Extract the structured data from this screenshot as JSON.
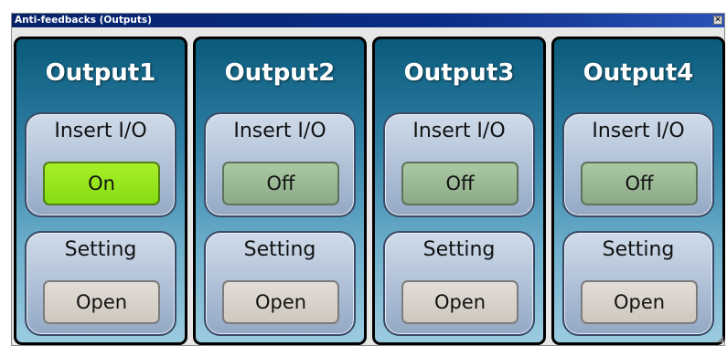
{
  "window": {
    "title": "Anti-feedbacks (Outputs)",
    "close_glyph": "✕"
  },
  "panels": [
    {
      "title": "Output1",
      "io": {
        "label": "Insert I/O",
        "button": "On",
        "state": "on"
      },
      "setting": {
        "label": "Setting",
        "button": "Open"
      }
    },
    {
      "title": "Output2",
      "io": {
        "label": "Insert I/O",
        "button": "Off",
        "state": "off"
      },
      "setting": {
        "label": "Setting",
        "button": "Open"
      }
    },
    {
      "title": "Output3",
      "io": {
        "label": "Insert I/O",
        "button": "Off",
        "state": "off"
      },
      "setting": {
        "label": "Setting",
        "button": "Open"
      }
    },
    {
      "title": "Output4",
      "io": {
        "label": "Insert I/O",
        "button": "Off",
        "state": "off"
      },
      "setting": {
        "label": "Setting",
        "button": "Open"
      }
    }
  ],
  "colors": {
    "on": "#86dc14",
    "off": "#8daa88",
    "open": "#cfc8bf",
    "panel_top": "#0a5a7a",
    "title_bar": "#0a2d86"
  }
}
